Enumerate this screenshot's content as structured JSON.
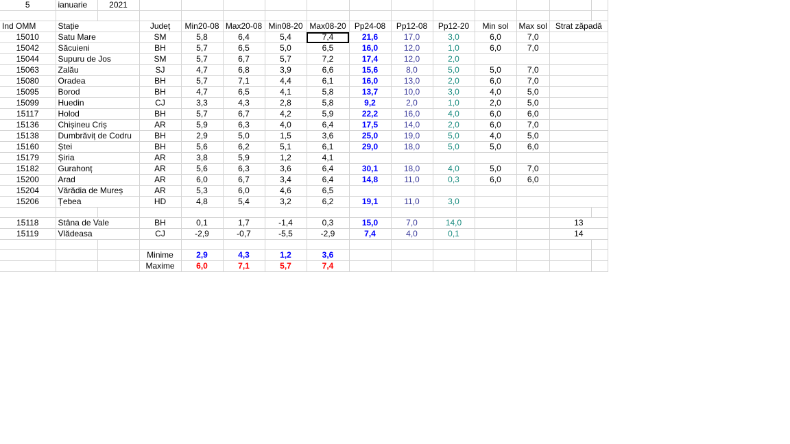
{
  "date": {
    "day": "5",
    "month": "ianuarie",
    "year": "2021"
  },
  "headers": [
    "Ind OMM",
    "Stație",
    "Județ",
    "Min20-08",
    "Max20-08",
    "Min08-20",
    "Max08-20",
    "Pp24-08",
    "Pp12-08",
    "Pp12-20",
    "Min sol",
    "Max sol",
    "Strat zăpadă"
  ],
  "rows": [
    [
      "15010",
      "Satu Mare",
      "SM",
      "5,8",
      "6,4",
      "5,4",
      "7,4",
      "21,6",
      "17,0",
      "3,0",
      "6,0",
      "7,0",
      ""
    ],
    [
      "15042",
      "Săcuieni",
      "BH",
      "5,7",
      "6,5",
      "5,0",
      "6,5",
      "16,0",
      "12,0",
      "1,0",
      "6,0",
      "7,0",
      ""
    ],
    [
      "15044",
      "Supuru de Jos",
      "SM",
      "5,7",
      "6,7",
      "5,7",
      "7,2",
      "17,4",
      "12,0",
      "2,0",
      "",
      "",
      ""
    ],
    [
      "15063",
      "Zalău",
      "SJ",
      "4,7",
      "6,8",
      "3,9",
      "6,6",
      "15,6",
      "8,0",
      "5,0",
      "5,0",
      "7,0",
      ""
    ],
    [
      "15080",
      "Oradea",
      "BH",
      "5,7",
      "7,1",
      "4,4",
      "6,1",
      "16,0",
      "13,0",
      "2,0",
      "6,0",
      "7,0",
      ""
    ],
    [
      "15095",
      "Borod",
      "BH",
      "4,7",
      "6,5",
      "4,1",
      "5,8",
      "13,7",
      "10,0",
      "3,0",
      "4,0",
      "5,0",
      ""
    ],
    [
      "15099",
      "Huedin",
      "CJ",
      "3,3",
      "4,3",
      "2,8",
      "5,8",
      "9,2",
      "2,0",
      "1,0",
      "2,0",
      "5,0",
      ""
    ],
    [
      "15117",
      "Holod",
      "BH",
      "5,7",
      "6,7",
      "4,2",
      "5,9",
      "22,2",
      "16,0",
      "4,0",
      "6,0",
      "6,0",
      ""
    ],
    [
      "15136",
      "Chișineu   Criș",
      "AR",
      "5,9",
      "6,3",
      "4,0",
      "6,4",
      "17,5",
      "14,0",
      "2,0",
      "6,0",
      "7,0",
      ""
    ],
    [
      "15138",
      "Dumbrăviț  de Codru",
      "BH",
      "2,9",
      "5,0",
      "1,5",
      "3,6",
      "25,0",
      "19,0",
      "5,0",
      "4,0",
      "5,0",
      ""
    ],
    [
      "15160",
      "Ștei",
      "BH",
      "5,6",
      "6,2",
      "5,1",
      "6,1",
      "29,0",
      "18,0",
      "5,0",
      "5,0",
      "6,0",
      ""
    ],
    [
      "15179",
      "Șiria",
      "AR",
      "3,8",
      "5,9",
      "1,2",
      "4,1",
      "",
      "",
      "",
      "",
      "",
      ""
    ],
    [
      "15182",
      "Gurahonț",
      "AR",
      "5,6",
      "6,3",
      "3,6",
      "6,4",
      "30,1",
      "18,0",
      "4,0",
      "5,0",
      "7,0",
      ""
    ],
    [
      "15200",
      "Arad",
      "AR",
      "6,0",
      "6,7",
      "3,4",
      "6,4",
      "14,8",
      "11,0",
      "0,3",
      "6,0",
      "6,0",
      ""
    ],
    [
      "15204",
      "Vărădia de Mureș",
      "AR",
      "5,3",
      "6,0",
      "4,6",
      "6,5",
      "",
      "",
      "",
      "",
      "",
      ""
    ],
    [
      "15206",
      "Țebea",
      "HD",
      "4,8",
      "5,4",
      "3,2",
      "6,2",
      "19,1",
      "11,0",
      "3,0",
      "",
      "",
      ""
    ]
  ],
  "mountain_rows": [
    [
      "15118",
      "Stâna de Vale",
      "BH",
      "0,1",
      "1,7",
      "-1,4",
      "0,3",
      "15,0",
      "7,0",
      "14,0",
      "",
      "",
      "13"
    ],
    [
      "15119",
      "Vlădeasa",
      "CJ",
      "-2,9",
      "-0,7",
      "-5,5",
      "-2,9",
      "7,4",
      "4,0",
      "0,1",
      "",
      "",
      "14"
    ]
  ],
  "minime": {
    "label": "Minime",
    "values": [
      "2,9",
      "4,3",
      "1,2",
      "3,6"
    ]
  },
  "maxime": {
    "label": "Maxime",
    "values": [
      "6,0",
      "7,1",
      "5,7",
      "7,4"
    ]
  },
  "colors": {
    "pp24": "#0000ff",
    "pp12_08": "#3b3b9b",
    "pp12_20": "#16897d",
    "max": "#ff0000",
    "grid": "#d4d4d4"
  }
}
